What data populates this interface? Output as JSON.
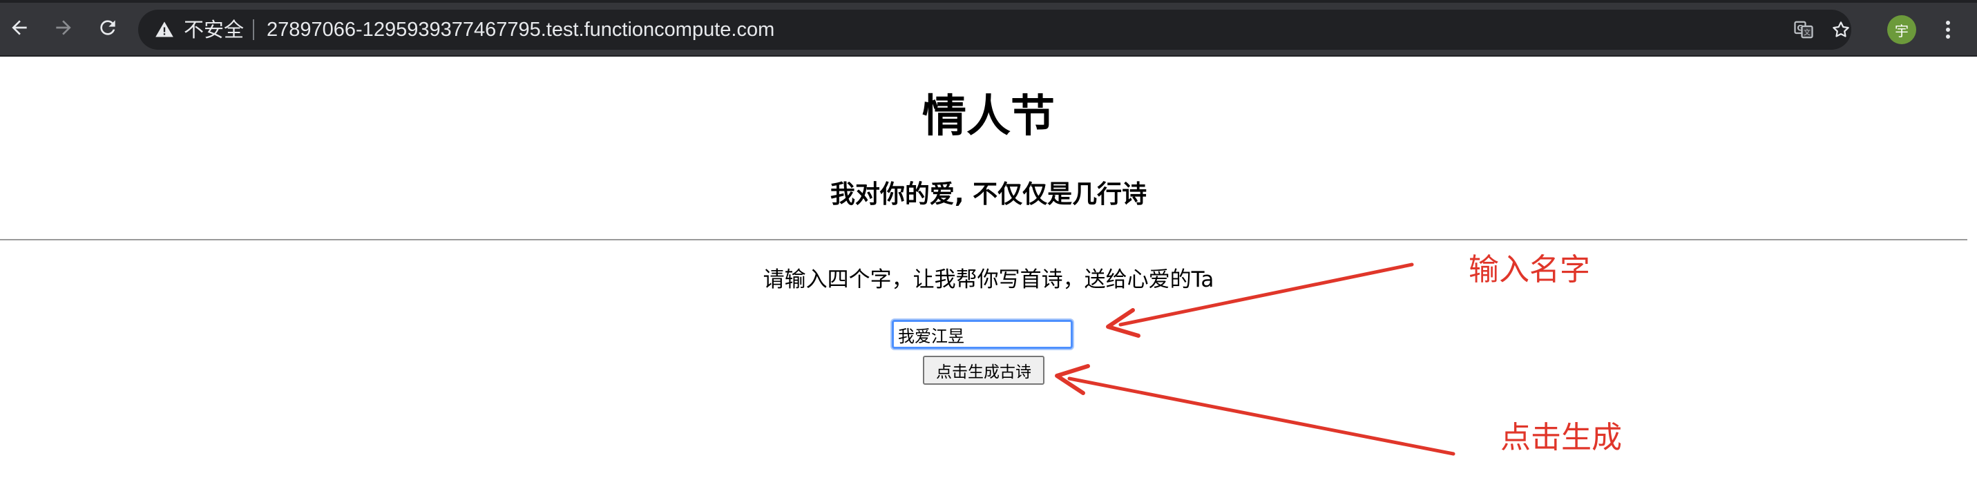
{
  "browser": {
    "security_label": "不安全",
    "url": "27897066-1295939377467795.test.functioncompute.com",
    "avatar_initial": "宇",
    "icons": [
      "back-arrow-icon",
      "forward-arrow-icon",
      "reload-icon",
      "warning-icon",
      "translate-icon",
      "star-icon",
      "more-vert-icon"
    ]
  },
  "page": {
    "title": "情人节",
    "subtitle": "我对你的爱, 不仅仅是几行诗",
    "prompt": "请输入四个字，让我帮你写首诗，送给心爱的Ta",
    "name_input_value": "我爱江昱",
    "generate_button_label": "点击生成古诗"
  },
  "annotations": {
    "input_label": "输入名字",
    "button_label": "点击生成",
    "color": "#e0362a"
  }
}
